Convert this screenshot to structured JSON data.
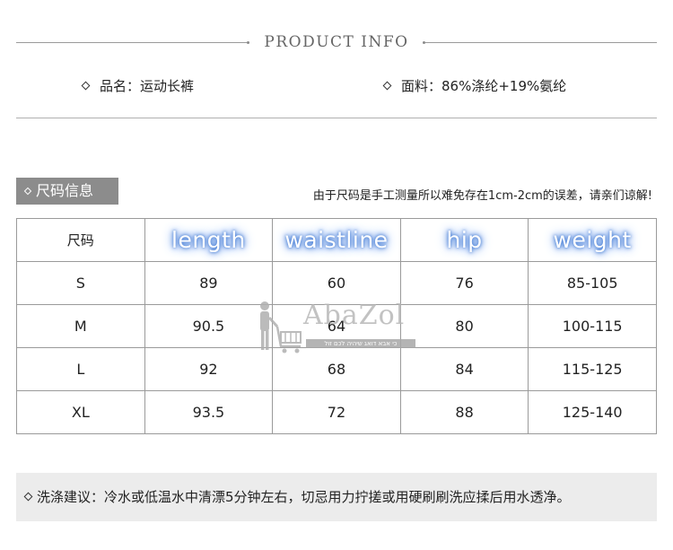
{
  "header": {
    "title": "PRODUCT INFO"
  },
  "info": {
    "name_label": "品名：运动长裤",
    "fabric_label": "面料：86%涤纶+19%氨纶"
  },
  "size_section": {
    "tag": "尺码信息",
    "note": "由于尺码是手工测量所以难免存在1cm-2cm的误差，请亲们谅解!"
  },
  "size_table": {
    "headers": [
      "尺码",
      "length",
      "waistline",
      "hip",
      "weight"
    ],
    "rows": [
      [
        "S",
        "89",
        "60",
        "76",
        "85-105"
      ],
      [
        "M",
        "90.5",
        "64",
        "80",
        "100-115"
      ],
      [
        "L",
        "92",
        "68",
        "84",
        "115-125"
      ],
      [
        "XL",
        "93.5",
        "72",
        "88",
        "125-140"
      ]
    ]
  },
  "watermark": {
    "brand": "AbaZol",
    "tagline": "כי אבא דואג שיהיה לכם זול"
  },
  "care": {
    "text": "洗涤建议：冷水或低温水中清漂5分钟左右，切忌用力拧搓或用硬刷刷洗应揉后用水透净。"
  }
}
